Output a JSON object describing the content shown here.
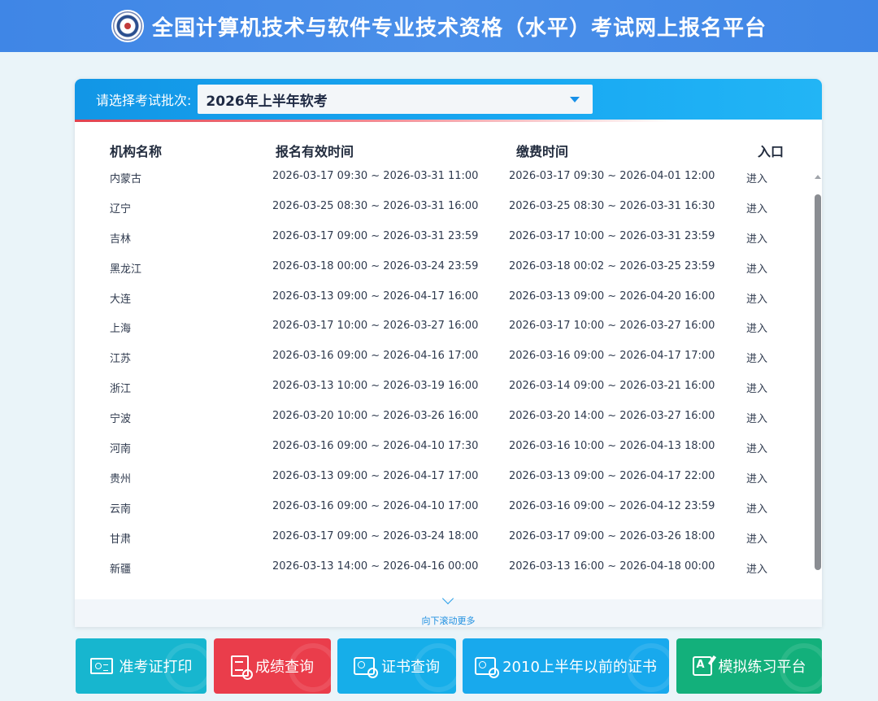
{
  "header": {
    "title": "全国计算机技术与软件专业技术资格（水平）考试网上报名平台"
  },
  "batch": {
    "label": "请选择考试批次:",
    "selected": "2026年上半年软考"
  },
  "table": {
    "columns": [
      "机构名称",
      "报名有效时间",
      "缴费时间",
      "入口"
    ],
    "rows": [
      {
        "org": "内蒙古",
        "reg_time": "2026-03-17 09:30 ~ 2026-03-31 11:00",
        "pay_time": "2026-03-17 09:30 ~ 2026-04-01 12:00",
        "entry": "进入"
      },
      {
        "org": "辽宁",
        "reg_time": "2026-03-25 08:30 ~ 2026-03-31 16:00",
        "pay_time": "2026-03-25 08:30 ~ 2026-03-31 16:30",
        "entry": "进入"
      },
      {
        "org": "吉林",
        "reg_time": "2026-03-17 09:00 ~ 2026-03-31 23:59",
        "pay_time": "2026-03-17 10:00 ~ 2026-03-31 23:59",
        "entry": "进入"
      },
      {
        "org": "黑龙江",
        "reg_time": "2026-03-18 00:00 ~ 2026-03-24 23:59",
        "pay_time": "2026-03-18 00:02 ~ 2026-03-25 23:59",
        "entry": "进入"
      },
      {
        "org": "大连",
        "reg_time": "2026-03-13 09:00 ~ 2026-04-17 16:00",
        "pay_time": "2026-03-13 09:00 ~ 2026-04-20 16:00",
        "entry": "进入"
      },
      {
        "org": "上海",
        "reg_time": "2026-03-17 10:00 ~ 2026-03-27 16:00",
        "pay_time": "2026-03-17 10:00 ~ 2026-03-27 16:00",
        "entry": "进入"
      },
      {
        "org": "江苏",
        "reg_time": "2026-03-16 09:00 ~ 2026-04-16 17:00",
        "pay_time": "2026-03-16 09:00 ~ 2026-04-17 17:00",
        "entry": "进入"
      },
      {
        "org": "浙江",
        "reg_time": "2026-03-13 10:00 ~ 2026-03-19 16:00",
        "pay_time": "2026-03-14 09:00 ~ 2026-03-21 16:00",
        "entry": "进入"
      },
      {
        "org": "宁波",
        "reg_time": "2026-03-20 10:00 ~ 2026-03-26 16:00",
        "pay_time": "2026-03-20 14:00 ~ 2026-03-27 16:00",
        "entry": "进入"
      },
      {
        "org": "河南",
        "reg_time": "2026-03-16 09:00 ~ 2026-04-10 17:30",
        "pay_time": "2026-03-16 10:00 ~ 2026-04-13 18:00",
        "entry": "进入"
      },
      {
        "org": "贵州",
        "reg_time": "2026-03-13 09:00 ~ 2026-04-17 17:00",
        "pay_time": "2026-03-13 09:00 ~ 2026-04-17 22:00",
        "entry": "进入"
      },
      {
        "org": "云南",
        "reg_time": "2026-03-16 09:00 ~ 2026-04-10 17:00",
        "pay_time": "2026-03-16 09:00 ~ 2026-04-12 23:59",
        "entry": "进入"
      },
      {
        "org": "甘肃",
        "reg_time": "2026-03-17 09:00 ~ 2026-03-24 18:00",
        "pay_time": "2026-03-17 09:00 ~ 2026-03-26 18:00",
        "entry": "进入"
      },
      {
        "org": "新疆",
        "reg_time": "2026-03-13 14:00 ~ 2026-04-16 00:00",
        "pay_time": "2026-03-13 16:00 ~ 2026-04-18 00:00",
        "entry": "进入"
      }
    ]
  },
  "scroll_more": "向下滚动更多",
  "buttons": [
    {
      "label": "准考证打印",
      "icon": "admission-card-icon",
      "color": "#17b6cf"
    },
    {
      "label": "成绩查询",
      "icon": "score-search-icon",
      "color": "#ea3d4b"
    },
    {
      "label": "证书查询",
      "icon": "certificate-search-icon",
      "color": "#16aee9"
    },
    {
      "label": "2010上半年以前的证书",
      "icon": "certificate-search-icon",
      "color": "#18a9ed"
    },
    {
      "label": "模拟练习平台",
      "icon": "practice-icon",
      "color": "#13b07b"
    }
  ]
}
